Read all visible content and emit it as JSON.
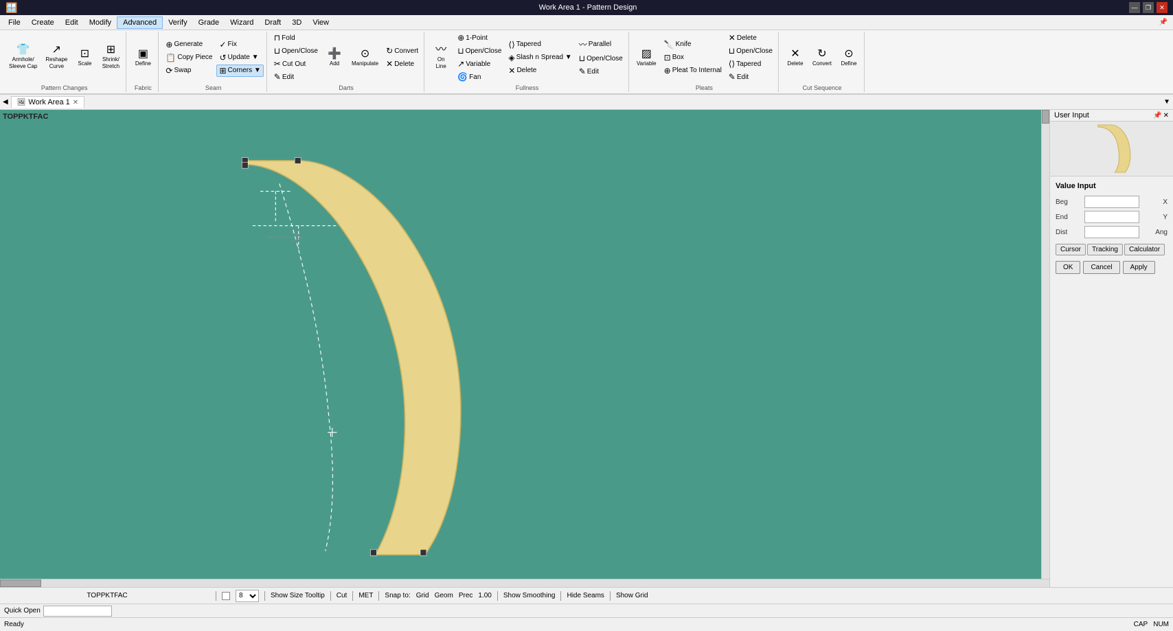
{
  "titleBar": {
    "title": "Work Area 1 - Pattern Design",
    "controls": [
      "—",
      "❐",
      "✕"
    ]
  },
  "menuBar": {
    "items": [
      "File",
      "Create",
      "Edit",
      "Modify",
      "Advanced",
      "Verify",
      "Grade",
      "Wizard",
      "Draft",
      "3D",
      "View"
    ]
  },
  "ribbon": {
    "tabs": [
      "Advanced"
    ],
    "groups": [
      {
        "label": "Pattern Changes",
        "items": [
          {
            "type": "big",
            "icon": "👕",
            "label": "Armhole/\nSleeve Cap"
          },
          {
            "type": "big",
            "icon": "↗",
            "label": "Reshape\nCurve"
          },
          {
            "type": "big",
            "icon": "⊡",
            "label": "Scale"
          },
          {
            "type": "big",
            "icon": "⊞",
            "label": "Shrink/\nStretch"
          }
        ]
      },
      {
        "label": "Fabric",
        "items": [
          {
            "type": "big",
            "icon": "▣",
            "label": "Define"
          }
        ]
      },
      {
        "label": "Seam",
        "items": [
          {
            "type": "small",
            "icon": "⊕",
            "label": "Generate"
          },
          {
            "type": "small",
            "icon": "✓",
            "label": "Fix"
          },
          {
            "type": "small",
            "icon": "📋",
            "label": "Copy Piece"
          },
          {
            "type": "small",
            "icon": "↺",
            "label": "Update ▼"
          },
          {
            "type": "small",
            "icon": "⟳",
            "label": "Swap"
          },
          {
            "type": "small",
            "icon": "⊞",
            "label": "Corners ▼"
          }
        ]
      },
      {
        "label": "Darts",
        "items": [
          {
            "type": "small",
            "icon": "⊓",
            "label": "Fold"
          },
          {
            "type": "small",
            "icon": "⊔",
            "label": "Open/Close"
          },
          {
            "type": "small",
            "icon": "✂",
            "label": "Cut Out"
          },
          {
            "type": "small",
            "icon": "✎",
            "label": "Edit"
          },
          {
            "type": "big",
            "icon": "➕",
            "label": "Add"
          },
          {
            "type": "big",
            "icon": "⊙",
            "label": "Manipulate"
          },
          {
            "type": "small",
            "icon": "↻",
            "label": "Convert"
          },
          {
            "type": "small",
            "icon": "✕",
            "label": "Delete"
          }
        ]
      },
      {
        "label": "Fullness",
        "items": [
          {
            "type": "big",
            "icon": "〰",
            "label": "On\nLine"
          },
          {
            "type": "small",
            "icon": "⊕",
            "label": "1-Point"
          },
          {
            "type": "small",
            "icon": "⊘",
            "label": "Open/Close"
          },
          {
            "type": "small",
            "icon": "↗",
            "label": "Variable"
          },
          {
            "type": "small",
            "icon": "🌀",
            "label": "Fan"
          },
          {
            "type": "small",
            "icon": "⟨⟩",
            "label": "Tapered"
          },
          {
            "type": "small",
            "icon": "◈",
            "label": "Slash n Spread ▼"
          },
          {
            "type": "small",
            "icon": "✕",
            "label": "Delete"
          },
          {
            "type": "small",
            "icon": "〰",
            "label": "Parallel"
          },
          {
            "type": "small",
            "icon": "⊔",
            "label": "Open/Close"
          },
          {
            "type": "small",
            "icon": "✎",
            "label": "Edit"
          }
        ]
      },
      {
        "label": "Pleats",
        "items": [
          {
            "type": "big",
            "icon": "▨",
            "label": "Variable"
          },
          {
            "type": "small",
            "icon": "🔪",
            "label": "Knife"
          },
          {
            "type": "small",
            "icon": "⊡",
            "label": "Box"
          },
          {
            "type": "small",
            "icon": "⊕",
            "label": "Pleat To Internal"
          },
          {
            "type": "small",
            "icon": "⊔",
            "label": "Open/Close"
          },
          {
            "type": "small",
            "icon": "✕",
            "label": "Delete"
          },
          {
            "type": "small",
            "icon": "⟨⟩",
            "label": "Tapered"
          },
          {
            "type": "small",
            "icon": "✎",
            "label": "Edit"
          }
        ]
      },
      {
        "label": "Cut Sequence",
        "items": [
          {
            "type": "big",
            "icon": "✕",
            "label": "Delete"
          },
          {
            "type": "big",
            "icon": "↻",
            "label": "Convert"
          },
          {
            "type": "big",
            "icon": "⊙",
            "label": "Define"
          }
        ]
      }
    ]
  },
  "workArea": {
    "tabLabel": "Work Area 1",
    "patternLabel": "TOPPKTFAC"
  },
  "rightPanel": {
    "title": "User Input",
    "valueInput": "Value Input",
    "fields": [
      {
        "label": "Beg",
        "value": "",
        "suffix": "X"
      },
      {
        "label": "End",
        "value": "",
        "suffix": "Y"
      },
      {
        "label": "Dist",
        "value": "",
        "suffix": "Ang"
      }
    ],
    "tabButtons": [
      "Cursor",
      "Tracking",
      "Calculator"
    ],
    "actionButtons": [
      "OK",
      "Cancel",
      "Apply"
    ]
  },
  "statusBar": {
    "patternName": "TOPPKTFAC",
    "zoomValue": "8",
    "showSizeTooltip": "Show Size Tooltip",
    "cut": "Cut",
    "met": "MET",
    "snapTo": "Snap to:",
    "grid": "Grid",
    "geom": "Geom",
    "prec": "Prec",
    "precValue": "1.00",
    "showSmoothing": "Show Smoothing",
    "hideSeams": "Hide Seams",
    "showGrid": "Show Grid"
  },
  "bottomBar": {
    "quickOpen": "Quick Open",
    "status": "Ready",
    "capsLock": "CAP",
    "numLock": "NUM"
  }
}
